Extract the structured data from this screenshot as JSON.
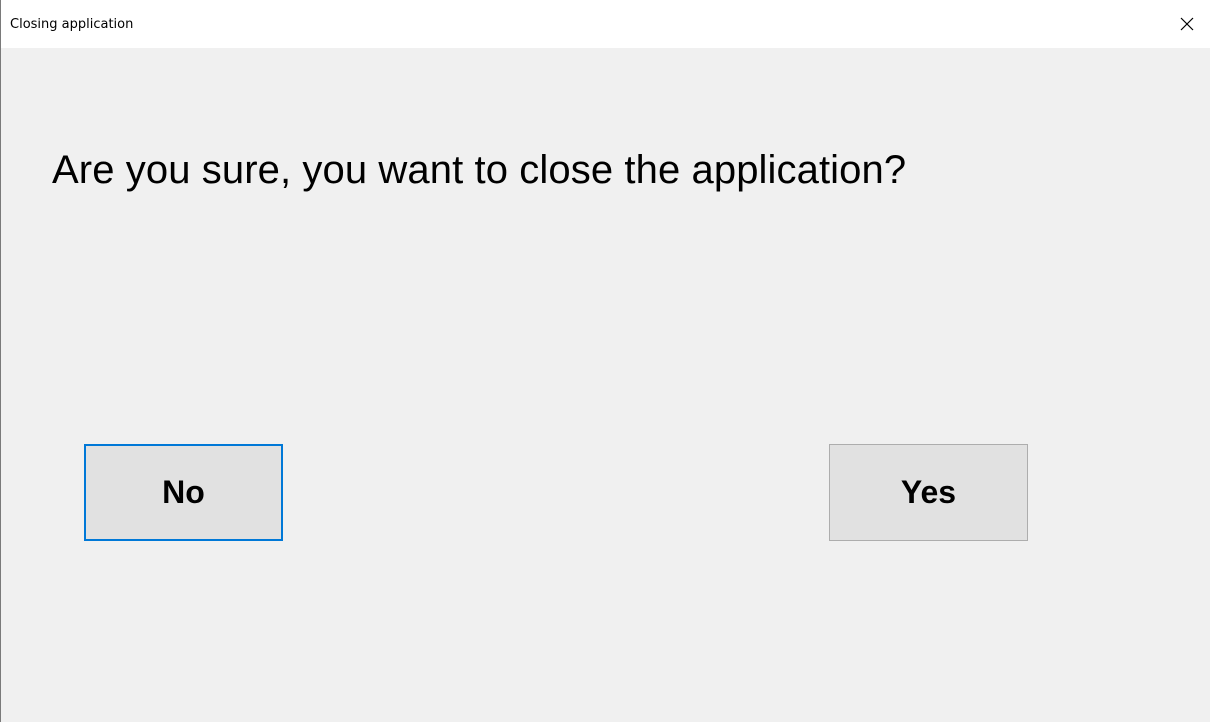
{
  "window": {
    "title": "Closing application",
    "close_icon": "close-icon"
  },
  "dialog": {
    "message": "Are you sure, you want to close the application?",
    "no_label": "No",
    "yes_label": "Yes",
    "focused_button": "No"
  },
  "colors": {
    "focus_border": "#0078d7",
    "button_face": "#e1e1e1",
    "dialog_background": "#f0f0f0"
  }
}
